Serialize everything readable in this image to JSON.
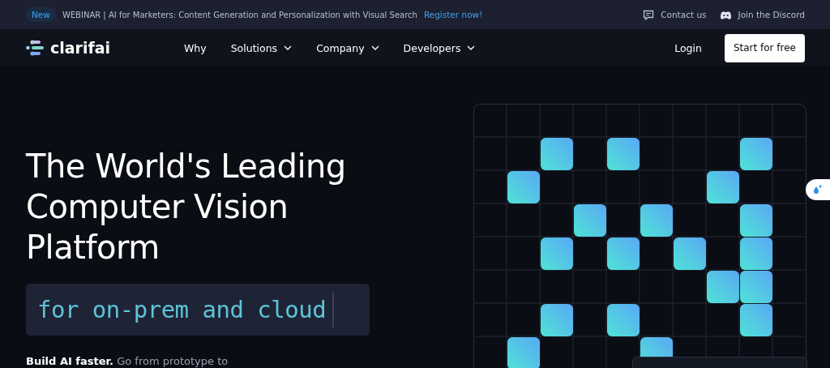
{
  "announcement": {
    "badge": "New",
    "text": "WEBINAR | AI for Marketers: Content Generation and Personalization with Visual Search",
    "link": "Register now!",
    "contact": "Contact us",
    "discord": "Join the Discord"
  },
  "nav": {
    "logo": "clarifai",
    "items": [
      {
        "label": "Why",
        "dropdown": false
      },
      {
        "label": "Solutions",
        "dropdown": true
      },
      {
        "label": "Company",
        "dropdown": true
      },
      {
        "label": "Developers",
        "dropdown": true
      }
    ],
    "login": "Login",
    "cta": "Start for free"
  },
  "hero": {
    "heading": "The World's Leading Computer Vision Platform",
    "typed": "for on-prem and cloud",
    "lead_bold": "Build AI faster.",
    "lead": "Go from prototype to"
  }
}
